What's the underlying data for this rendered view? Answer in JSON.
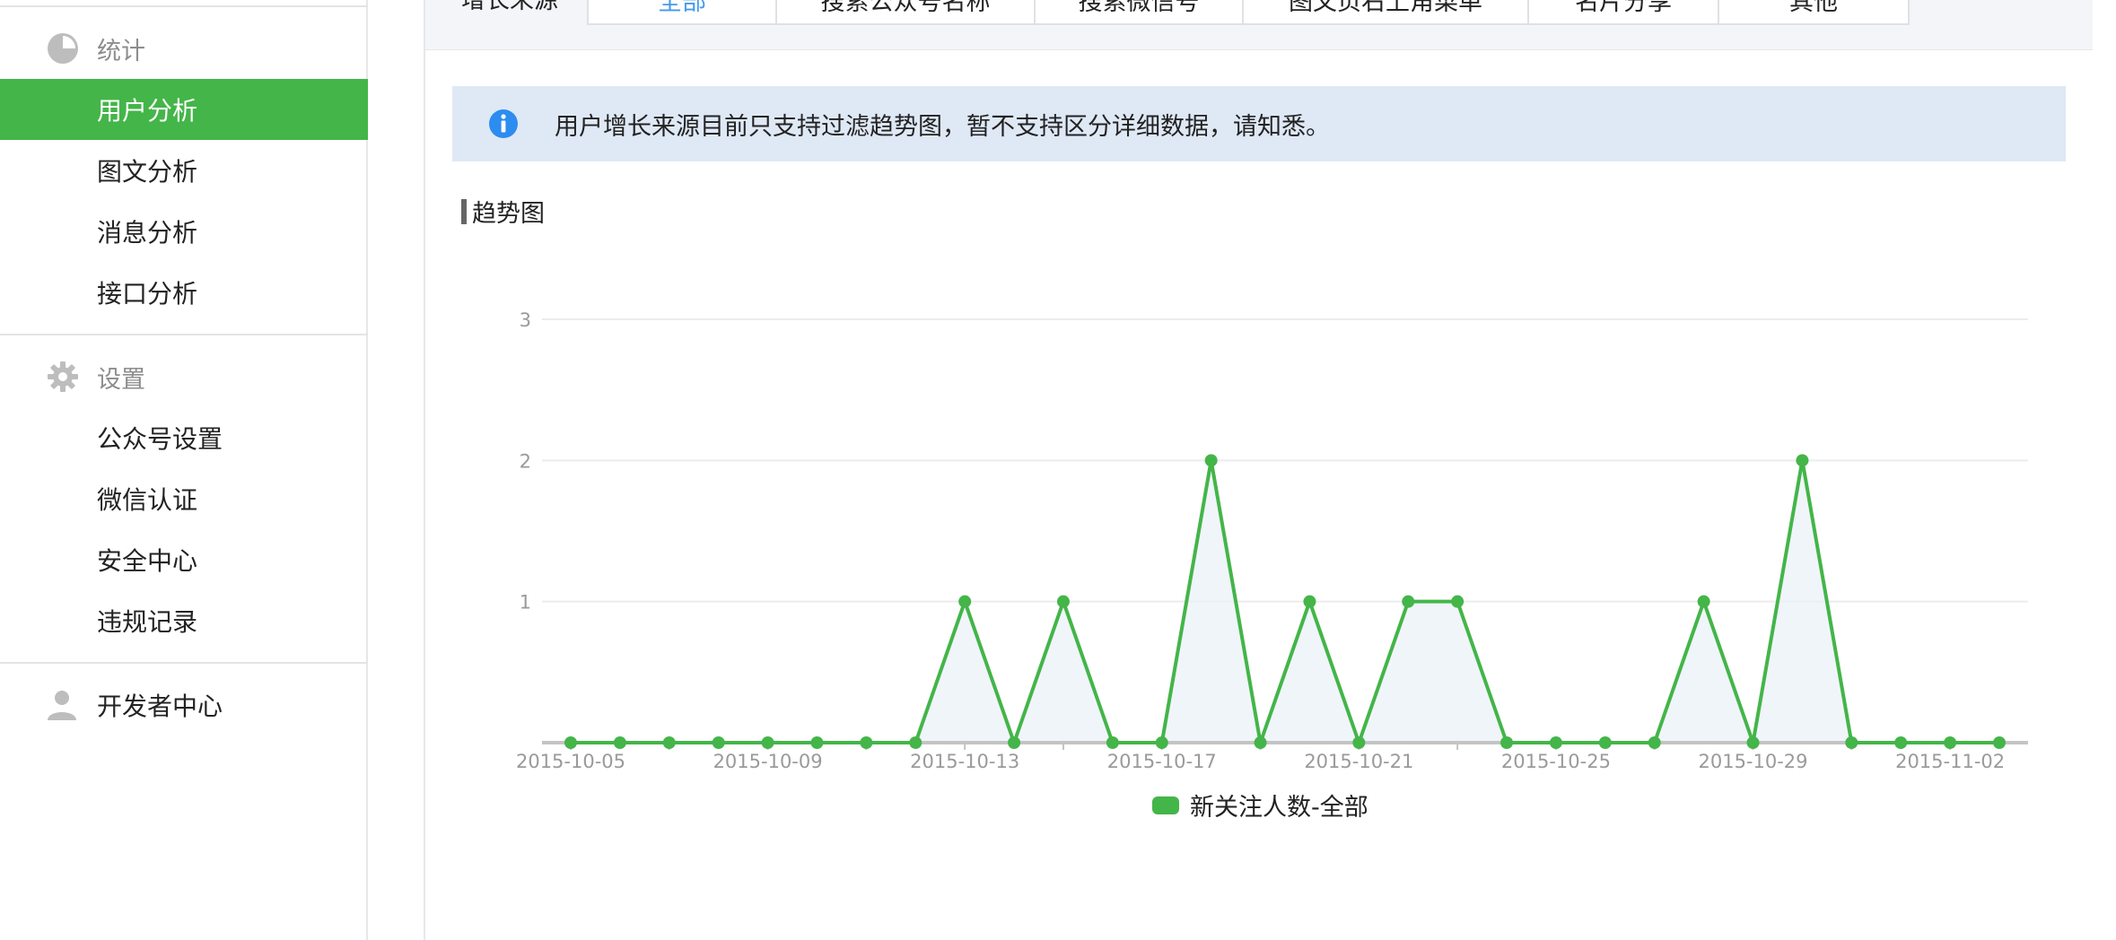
{
  "sidebar": {
    "stats": {
      "label": "统计",
      "icon": "pie-chart-icon"
    },
    "stats_items": [
      {
        "label": "用户分析",
        "active": true
      },
      {
        "label": "图文分析",
        "active": false
      },
      {
        "label": "消息分析",
        "active": false
      },
      {
        "label": "接口分析",
        "active": false
      }
    ],
    "settings": {
      "label": "设置",
      "icon": "gear-icon"
    },
    "settings_items": [
      {
        "label": "公众号设置"
      },
      {
        "label": "微信认证"
      },
      {
        "label": "安全中心"
      },
      {
        "label": "违规记录"
      }
    ],
    "developer": {
      "label": "开发者中心",
      "icon": "user-icon"
    }
  },
  "tabs": {
    "title": "增长来源",
    "items": [
      {
        "label": "全部",
        "active": true
      },
      {
        "label": "搜索公众号名称",
        "active": false
      },
      {
        "label": "搜索微信号",
        "active": false
      },
      {
        "label": "图文页右上角菜单",
        "active": false
      },
      {
        "label": "名片分享",
        "active": false
      },
      {
        "label": "其他",
        "active": false
      }
    ]
  },
  "notice": {
    "icon": "info-icon",
    "text": "用户增长来源目前只支持过滤趋势图，暂不支持区分详细数据，请知悉。"
  },
  "section": {
    "title": "趋势图"
  },
  "colors": {
    "accent": "#44b549",
    "tab_active": "#459ae9",
    "notice_bg": "#dfe8f5",
    "info": "#2d8cf0"
  },
  "chart_data": {
    "type": "area",
    "x": [
      "2015-10-05",
      "2015-10-06",
      "2015-10-07",
      "2015-10-08",
      "2015-10-09",
      "2015-10-10",
      "2015-10-11",
      "2015-10-12",
      "2015-10-13",
      "2015-10-14",
      "2015-10-15",
      "2015-10-16",
      "2015-10-17",
      "2015-10-18",
      "2015-10-19",
      "2015-10-20",
      "2015-10-21",
      "2015-10-22",
      "2015-10-23",
      "2015-10-24",
      "2015-10-25",
      "2015-10-26",
      "2015-10-27",
      "2015-10-28",
      "2015-10-29",
      "2015-10-30",
      "2015-10-31",
      "2015-11-01",
      "2015-11-02",
      "2015-11-03"
    ],
    "x_tick_labels": [
      "2015-10-05",
      "2015-10-09",
      "2015-10-13",
      "2015-10-17",
      "2015-10-21",
      "2015-10-25",
      "2015-10-29",
      "2015-11-02"
    ],
    "series": [
      {
        "name": "新关注人数-全部",
        "values": [
          0,
          0,
          0,
          0,
          0,
          0,
          0,
          0,
          1,
          0,
          1,
          0,
          0,
          2,
          0,
          1,
          0,
          1,
          1,
          0,
          0,
          0,
          0,
          1,
          0,
          2,
          0,
          0,
          0,
          0
        ]
      }
    ],
    "y_ticks": [
      "1",
      "2",
      "3"
    ],
    "ylim": [
      0,
      3
    ],
    "grid": true,
    "legend": "bottom-center"
  }
}
